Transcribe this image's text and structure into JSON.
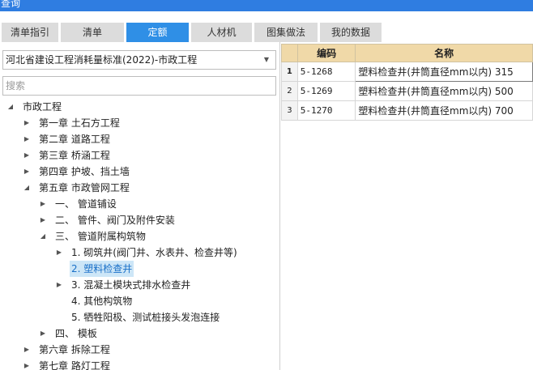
{
  "window": {
    "title": "查询"
  },
  "tabs": [
    {
      "label": "清单指引",
      "active": false
    },
    {
      "label": "清单",
      "active": false
    },
    {
      "label": "定额",
      "active": true
    },
    {
      "label": "人材机",
      "active": false
    },
    {
      "label": "图集做法",
      "active": false
    },
    {
      "label": "我的数据",
      "active": false
    }
  ],
  "standard_select": {
    "value": "河北省建设工程消耗量标准(2022)-市政工程"
  },
  "search": {
    "placeholder": "搜索"
  },
  "tree": [
    {
      "label": "市政工程",
      "expanded": true,
      "level": 0
    },
    {
      "label": "第一章 土石方工程",
      "expanded": false,
      "level": 1
    },
    {
      "label": "第二章 道路工程",
      "expanded": false,
      "level": 1
    },
    {
      "label": "第三章 桥涵工程",
      "expanded": false,
      "level": 1
    },
    {
      "label": "第四章 护坡、挡土墙",
      "expanded": false,
      "level": 1
    },
    {
      "label": "第五章 市政管网工程",
      "expanded": true,
      "level": 1
    },
    {
      "label": "一、 管道铺设",
      "expanded": false,
      "level": 2
    },
    {
      "label": "二、 管件、阀门及附件安装",
      "expanded": false,
      "level": 2
    },
    {
      "label": "三、 管道附属构筑物",
      "expanded": true,
      "level": 2
    },
    {
      "label": "1. 砌筑井(阀门井、水表井、检查井等)",
      "expanded": false,
      "level": 3
    },
    {
      "label": "2. 塑料检查井",
      "leaf": true,
      "selected": true,
      "level": 3
    },
    {
      "label": "3. 混凝土模块式排水检查井",
      "expanded": false,
      "level": 3
    },
    {
      "label": "4. 其他构筑物",
      "leaf": true,
      "level": 3
    },
    {
      "label": "5. 牺牲阳极、测试桩接头发泡连接",
      "leaf": true,
      "level": 3
    },
    {
      "label": "四、 模板",
      "expanded": false,
      "level": 2
    },
    {
      "label": "第六章 拆除工程",
      "expanded": false,
      "level": 1
    },
    {
      "label": "第七章 路灯工程",
      "expanded": false,
      "level": 1
    }
  ],
  "table": {
    "columns": [
      "",
      "编码",
      "名称"
    ],
    "rows": [
      {
        "num": "1",
        "code": "5-1268",
        "name": "塑料检查井(井筒直径mm以内) 315",
        "selected": true
      },
      {
        "num": "2",
        "code": "5-1269",
        "name": "塑料检查井(井筒直径mm以内) 500"
      },
      {
        "num": "3",
        "code": "5-1270",
        "name": "塑料检查井(井筒直径mm以内) 700"
      }
    ]
  },
  "colors": {
    "accent": "#2f8fe6",
    "selection": "#cde6f7",
    "header": "#f0d9a8"
  },
  "icons": {
    "expanded": "triangle-down-icon",
    "collapsed": "triangle-right-icon",
    "dropdown": "chevron-down-icon"
  }
}
